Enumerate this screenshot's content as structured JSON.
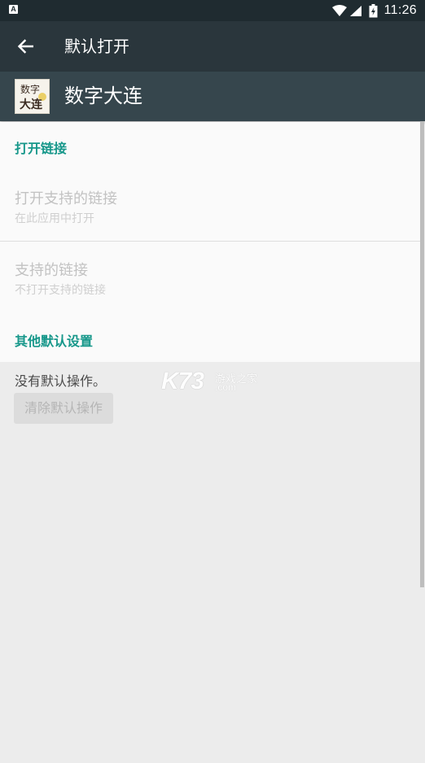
{
  "status_bar": {
    "notification_icon": "A",
    "icons": [
      "wifi-icon",
      "cell-signal-icon",
      "battery-icon"
    ],
    "time": "11:26"
  },
  "toolbar": {
    "back_icon": "arrow-left-icon",
    "title": "默认打开"
  },
  "app": {
    "name": "数字大连",
    "icon_text_line1": "数字",
    "icon_text_line2": "大连"
  },
  "sections": {
    "open_links": {
      "title": "打开链接",
      "items": [
        {
          "title": "打开支持的链接",
          "summary": "在此应用中打开"
        },
        {
          "title": "支持的链接",
          "summary": "不打开支持的链接"
        }
      ]
    },
    "other_defaults": {
      "title": "其他默认设置",
      "no_defaults_text": "没有默认操作。",
      "clear_button_label": "清除默认操作"
    }
  },
  "watermark": {
    "brand": "K73",
    "text_cn": "游戏之家",
    "text_domain": ".com"
  },
  "colors": {
    "accent": "#16978a",
    "toolbar": "#2a363c",
    "app_header": "#36464d",
    "status_bar": "#1f2b30"
  }
}
